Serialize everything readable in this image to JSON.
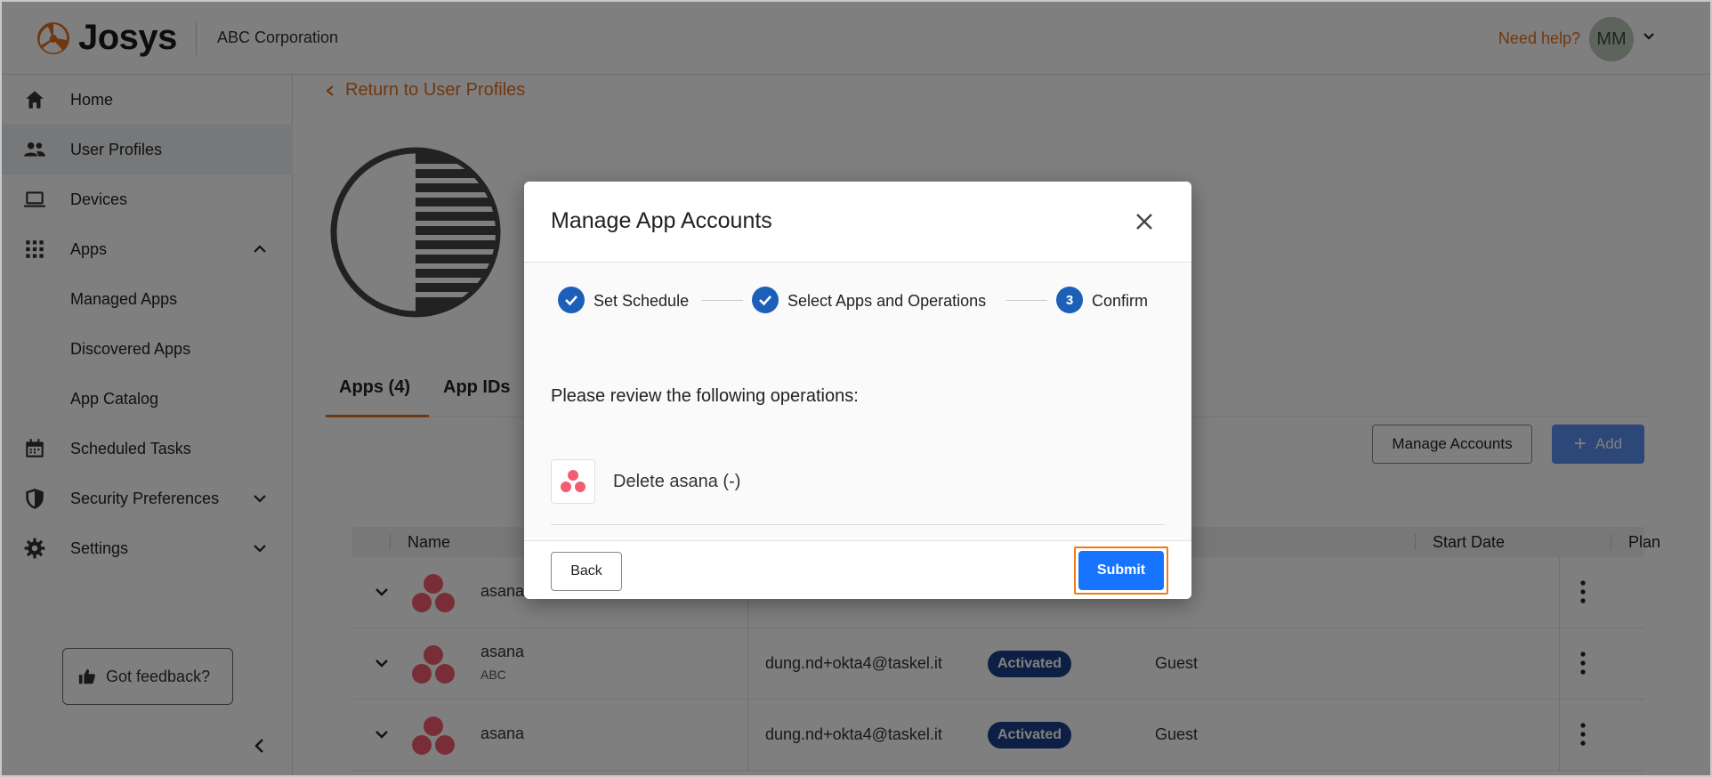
{
  "header": {
    "logo_text": "Josys",
    "org_name": "ABC Corporation",
    "need_help": "Need help?",
    "avatar_initials": "MM"
  },
  "sidebar": {
    "items": [
      {
        "label": "Home",
        "icon": "home-icon"
      },
      {
        "label": "User Profiles",
        "icon": "users-icon",
        "active": true
      },
      {
        "label": "Devices",
        "icon": "laptop-icon"
      },
      {
        "label": "Apps",
        "icon": "apps-grid-icon",
        "expanded": true
      },
      {
        "label": "Managed Apps"
      },
      {
        "label": "Discovered Apps"
      },
      {
        "label": "App Catalog"
      },
      {
        "label": "Scheduled Tasks",
        "icon": "calendar-icon"
      },
      {
        "label": "Security Preferences",
        "icon": "shield-icon"
      },
      {
        "label": "Settings",
        "icon": "gear-icon"
      }
    ],
    "feedback": "Got feedback?"
  },
  "main": {
    "back_link": "Return to User Profiles",
    "tabs": [
      {
        "label": "Apps (4)",
        "active": true
      },
      {
        "label": "App IDs"
      }
    ],
    "buttons": {
      "manage": "Manage Accounts",
      "add": "Add"
    },
    "table": {
      "headers": [
        "Name",
        "Start Date",
        "Plan"
      ],
      "rows": [
        {
          "name": "asana",
          "sub": "",
          "email": "",
          "status": "",
          "plan": ""
        },
        {
          "name": "asana",
          "sub": "ABC",
          "email": "dung.nd+okta4@taskel.it",
          "status": "Activated",
          "plan": "Guest"
        },
        {
          "name": "asana",
          "sub": "",
          "email": "dung.nd+okta4@taskel.it",
          "status": "Activated",
          "plan": "Guest"
        }
      ]
    }
  },
  "modal": {
    "title": "Manage App Accounts",
    "steps": [
      {
        "label": "Set Schedule",
        "state": "done"
      },
      {
        "label": "Select Apps and Operations",
        "state": "done"
      },
      {
        "label": "Confirm",
        "number": "3",
        "state": "current"
      }
    ],
    "review_text": "Please review the following operations:",
    "operations": [
      {
        "text": "Delete asana (-)",
        "app": "asana"
      }
    ],
    "back_label": "Back",
    "submit_label": "Submit"
  },
  "colors": {
    "accent_orange": "#e07020",
    "primary_blue": "#1774ff",
    "step_blue": "#1c5fb8",
    "badge_navy": "#1c3f8a"
  }
}
